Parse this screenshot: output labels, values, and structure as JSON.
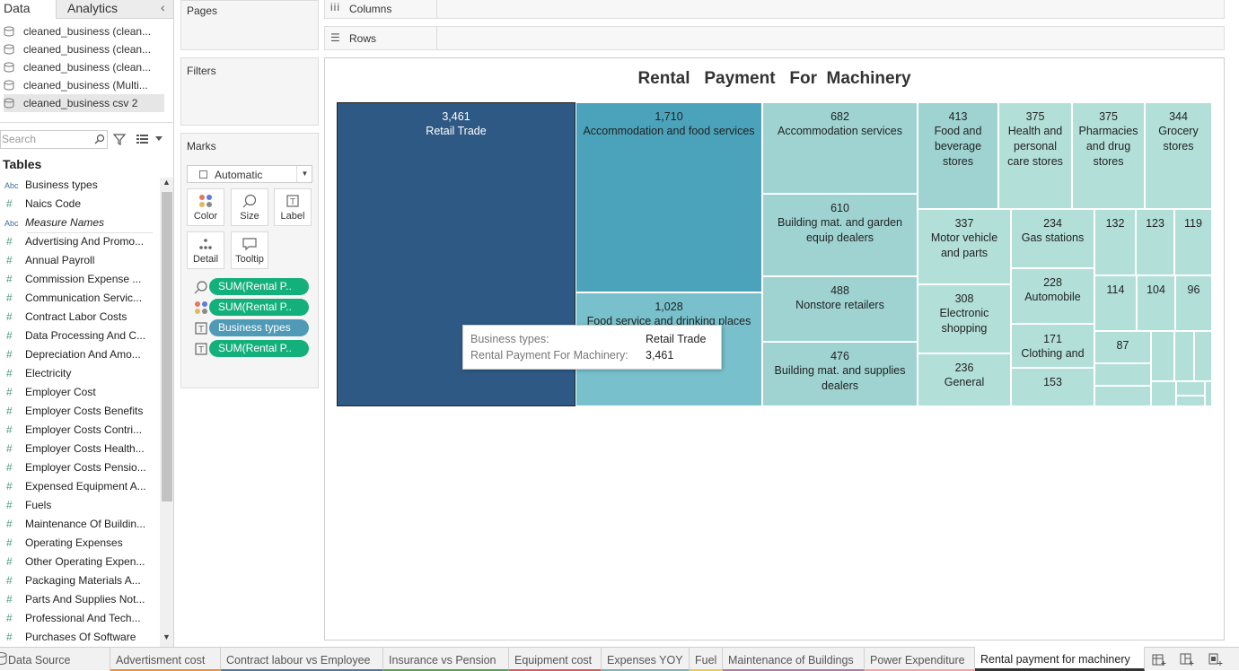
{
  "left_pane": {
    "tabs": [
      "Data",
      "Analytics"
    ],
    "data_sources": [
      "cleaned_business (clean...",
      "cleaned_business (clean...",
      "cleaned_business (clean...",
      "cleaned_business (Multi...",
      "cleaned_business csv 2"
    ],
    "search_placeholder": "Search",
    "tables_label": "Tables",
    "fields": [
      {
        "type": "abc",
        "name": "Business types"
      },
      {
        "type": "num",
        "name": "Naics Code"
      },
      {
        "type": "abc",
        "name": "Measure Names"
      },
      {
        "type": "num",
        "name": "Advertising And Promo..."
      },
      {
        "type": "num",
        "name": "Annual Payroll"
      },
      {
        "type": "num",
        "name": "Commission Expense ..."
      },
      {
        "type": "num",
        "name": "Communication Servic..."
      },
      {
        "type": "num",
        "name": "Contract Labor Costs"
      },
      {
        "type": "num",
        "name": "Data Processing And C..."
      },
      {
        "type": "num",
        "name": "Depreciation And Amo..."
      },
      {
        "type": "num",
        "name": "Electricity"
      },
      {
        "type": "num",
        "name": "Employer Cost"
      },
      {
        "type": "num",
        "name": "Employer Costs Benefits"
      },
      {
        "type": "num",
        "name": "Employer Costs Contri..."
      },
      {
        "type": "num",
        "name": "Employer Costs Health..."
      },
      {
        "type": "num",
        "name": "Employer Costs Pensio..."
      },
      {
        "type": "num",
        "name": "Expensed Equipment A..."
      },
      {
        "type": "num",
        "name": "Fuels"
      },
      {
        "type": "num",
        "name": "Maintenance Of Buildin..."
      },
      {
        "type": "num",
        "name": "Operating Expenses"
      },
      {
        "type": "num",
        "name": "Other Operating Expen..."
      },
      {
        "type": "num",
        "name": "Packaging Materials A..."
      },
      {
        "type": "num",
        "name": "Parts And Supplies Not..."
      },
      {
        "type": "num",
        "name": "Professional And Tech..."
      },
      {
        "type": "num",
        "name": "Purchases Of Software"
      }
    ]
  },
  "shelves": {
    "pages": "Pages",
    "filters": "Filters",
    "marks": "Marks",
    "mark_type": "Automatic",
    "buttons": [
      "Color",
      "Size",
      "Label",
      "Detail",
      "Tooltip"
    ],
    "pills": [
      "SUM(Rental P..",
      "SUM(Rental P..",
      "Business types",
      "SUM(Rental P.."
    ],
    "columns": "Columns",
    "rows": "Rows"
  },
  "chart_data": {
    "type": "treemap",
    "title": "Rental   Payment   For  Machinery",
    "nodes": [
      {
        "label": "Retail Trade",
        "value": 3461
      },
      {
        "label": "Accommodation and food services",
        "value": 1710
      },
      {
        "label": "Food service and drinking places",
        "value": 1028
      },
      {
        "label": "Accommodation services",
        "value": 682
      },
      {
        "label": "Building mat. and garden equip dealers",
        "value": 610
      },
      {
        "label": "Nonstore retailers",
        "value": 488
      },
      {
        "label": "Building mat. and supplies dealers",
        "value": 476
      },
      {
        "label": "Food and beverage stores",
        "value": 413
      },
      {
        "label": "Health and personal care stores",
        "value": 375
      },
      {
        "label": "Pharmacies and drug stores",
        "value": 375
      },
      {
        "label": "Grocery stores",
        "value": 344
      },
      {
        "label": "Motor vehicle and parts",
        "value": 337
      },
      {
        "label": "Electronic shopping",
        "value": 308
      },
      {
        "label": "General",
        "value": 236
      },
      {
        "label": "Gas stations",
        "value": 234
      },
      {
        "label": "Automobile",
        "value": 228
      },
      {
        "label": "Clothing and",
        "value": 171
      },
      {
        "label": "",
        "value": 153
      },
      {
        "label": "",
        "value": 132
      },
      {
        "label": "",
        "value": 123
      },
      {
        "label": "",
        "value": 119
      },
      {
        "label": "",
        "value": 114
      },
      {
        "label": "",
        "value": 104
      },
      {
        "label": "",
        "value": 96
      },
      {
        "label": "",
        "value": 87
      }
    ]
  },
  "tooltip": {
    "rows": [
      {
        "key": "Business types:",
        "value": "Retail Trade"
      },
      {
        "key": "Rental Payment For Machinery:",
        "value": "3,461"
      }
    ]
  },
  "sheet_tabs": [
    "Data Source",
    "Advertisment  cost",
    "Contract  labour vs Employee",
    "Insurance  vs  Pension",
    "Equipment cost",
    "Expenses  YOY",
    "Fuel",
    "Maintenance of Buildings",
    "Power  Expenditure",
    "Rental payment for machinery"
  ],
  "colors": {
    "selected": "#2e5984",
    "dark": "#4aa3bb",
    "mid": "#77c0cc",
    "light": "#9ed3d2",
    "lighter": "#b2e0d8",
    "pill_green": "#14b07c",
    "pill_blue": "#4f9ab7"
  }
}
